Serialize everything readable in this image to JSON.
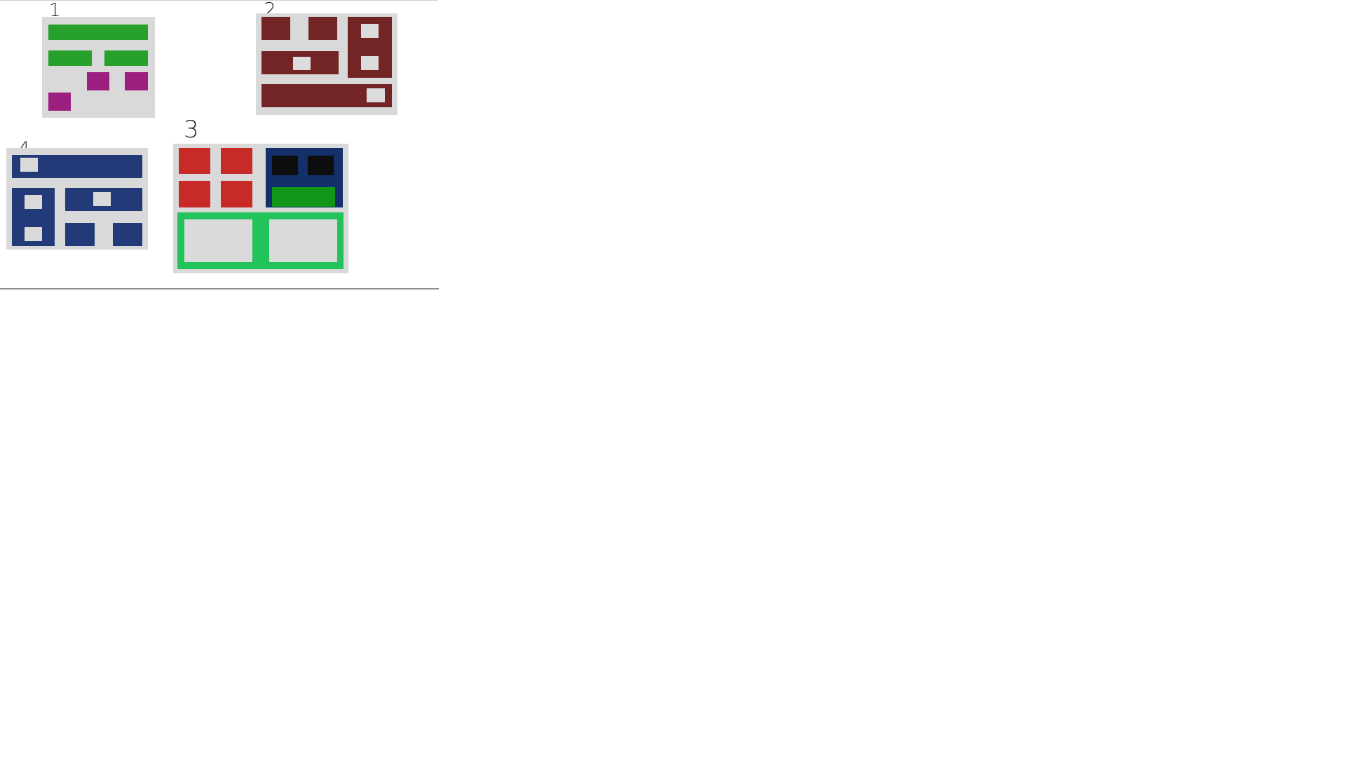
{
  "canvas": {
    "background": "#ffffff"
  },
  "layouts": [
    {
      "number": "1",
      "colors": {
        "panel": "#d9d9d9",
        "bars": "#27a02c",
        "squares": "#9c1f80"
      }
    },
    {
      "number": "2",
      "colors": {
        "panel": "#d9d9d9",
        "blocks": "#722524",
        "inner": "#dcdcdc"
      }
    },
    {
      "number": "3",
      "colors": {
        "panel": "#d9d9d9",
        "squares": "#c82a28",
        "box": "#13306a",
        "dark": "#0e0e0e",
        "bar": "#119617",
        "frame": "#23c35c"
      }
    },
    {
      "number": "4",
      "colors": {
        "panel": "#d9d9d9",
        "blocks": "#223b78",
        "inner": "#dadada"
      }
    }
  ]
}
